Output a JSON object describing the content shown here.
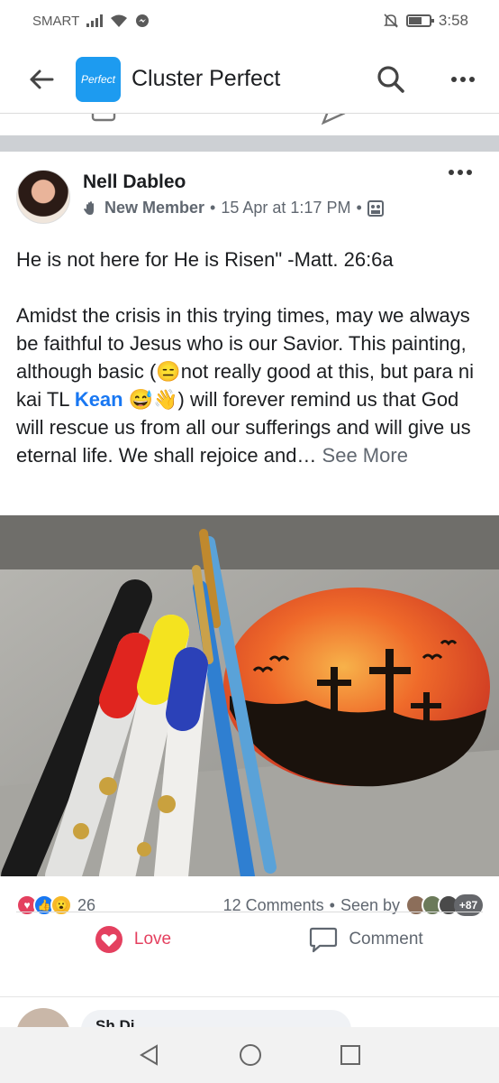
{
  "status_bar": {
    "carrier": "SMART",
    "time": "3:58"
  },
  "header": {
    "logo_text": "Perfect",
    "title": "Cluster Perfect"
  },
  "post": {
    "author": "Nell Dableo",
    "badge": "New Member",
    "timestamp": "15 Apr at 1:17 PM",
    "text": {
      "line1": "He is not here for He is Risen\" -Matt. 26:6a",
      "p2_before_mention": "Amidst the crisis in this trying times, may we always be faithful to Jesus who is our Savior. This painting, although basic (😑not really good at this, but para ni kai TL ",
      "mention": "Kean",
      "p2_after_mention": " 😅👋) will forever remind us that God will rescue us from all our sufferings and will give us eternal life. We shall rejoice and… ",
      "see_more": "See More"
    },
    "reactions_count": "26",
    "comments": "12 Comments",
    "seen_by": "Seen by",
    "seen_more": "+87"
  },
  "actions": {
    "love": "Love",
    "comment": "Comment"
  },
  "comment_preview": {
    "name": "Sh  Di"
  },
  "colors": {
    "love": "#e4405f",
    "like": "#1877f2",
    "mention": "#1877f2",
    "logo": "#1d9bf0"
  }
}
